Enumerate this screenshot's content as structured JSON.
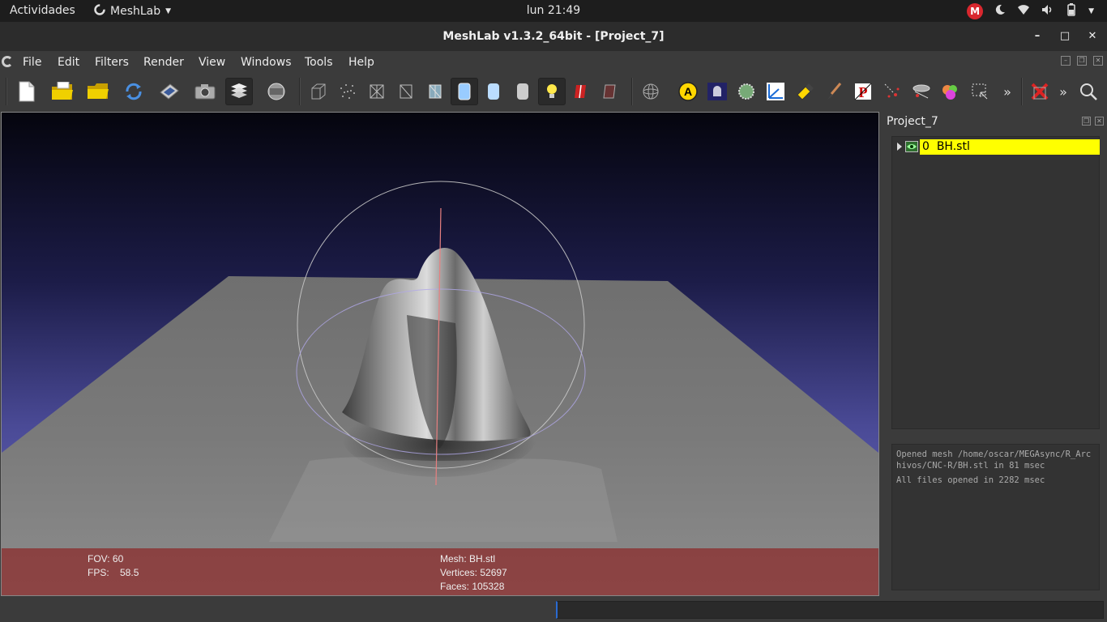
{
  "topbar": {
    "activities": "Actividades",
    "app_name": "MeshLab",
    "clock": "lun 21:49",
    "mega_label": "M",
    "tray_icons": [
      "mega-icon",
      "night-light-icon",
      "wifi-icon",
      "volume-icon",
      "battery-icon",
      "chevron-down-icon"
    ]
  },
  "window": {
    "title": "MeshLab v1.3.2_64bit - [Project_7]",
    "minimize": "–",
    "maximize": "□",
    "close": "✕"
  },
  "menu": [
    "File",
    "Edit",
    "Filters",
    "Render",
    "View",
    "Windows",
    "Tools",
    "Help"
  ],
  "toolbar": {
    "overflow": "»",
    "icons": [
      "new-document-icon",
      "open-folder-icon",
      "open-project-icon",
      "reload-icon",
      "save-icon",
      "snapshot-icon",
      "layers-icon",
      "layers-panel-icon",
      "bounding-box-icon",
      "points-icon",
      "wireframe-icon",
      "hidden-lines-icon",
      "flat-lines-icon",
      "flat-shading-icon",
      "smooth-shading-icon",
      "texture-icon",
      "lighting-icon",
      "backface-icon",
      "double-side-icon",
      "trackball-icon",
      "annotation-icon",
      "shader-icon",
      "sample-icon",
      "axes-icon",
      "paint-icon",
      "brush-icon",
      "measure-icon",
      "select-vertices-icon",
      "align-icon",
      "color-icon",
      "select-faces-icon",
      "delete-icon",
      "search-icon"
    ]
  },
  "viewport": {
    "info": {
      "fov": "FOV: 60",
      "fps": "FPS:    58.5",
      "mesh": "Mesh: BH.stl",
      "vertices": "Vertices: 52697",
      "faces": "Faces: 105328"
    }
  },
  "layers_panel": {
    "title": "Project_7",
    "layers": [
      {
        "index": "0",
        "name": "BH.stl",
        "selected": true
      }
    ]
  },
  "log": [
    "Opened mesh /home/oscar/MEGAsync/R_Archivos/CNC-R/BH.stl in 81 msec",
    "All files opened in 2282 msec"
  ],
  "colors": {
    "selection": "#ffff00",
    "info_bar": "#8c2828",
    "accent": "#2a6ad0"
  }
}
